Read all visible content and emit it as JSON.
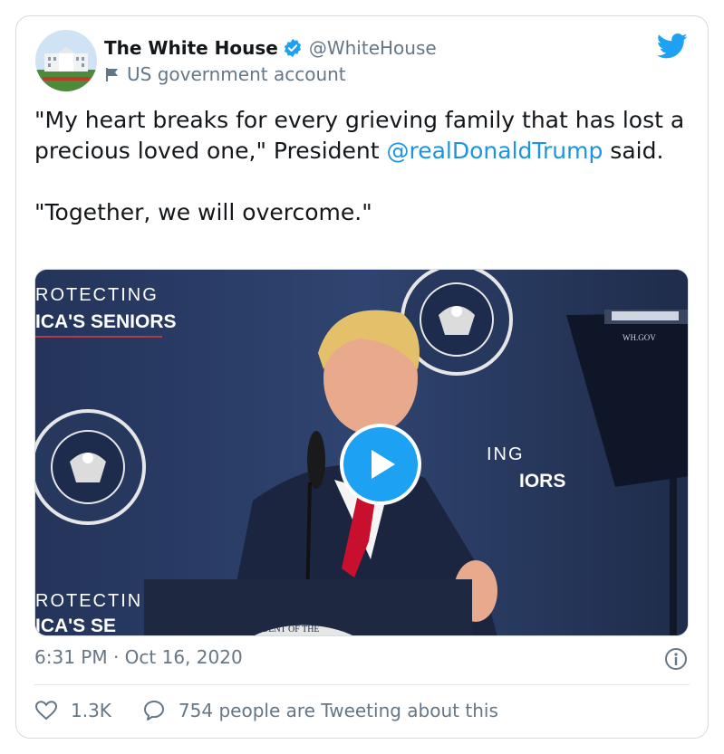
{
  "account": {
    "display_name": "The White House",
    "handle": "@WhiteHouse",
    "label": "US government account",
    "verified": true
  },
  "tweet": {
    "text_before_mention": "\"My heart breaks for every grieving family that has lost a precious loved one,\" President ",
    "mention": "@realDonaldTrump",
    "text_after_mention": " said.",
    "second_paragraph": "\"Together, we will overcome.\""
  },
  "media": {
    "banner_top_line1": "ROTECTING",
    "banner_top_line2": "ICA'S SENIORS",
    "banner_mid_line1": "ING",
    "banner_mid_line2": "IORS",
    "banner_bottom_line1": "ROTECTIN",
    "banner_bottom_line2": "ICA'S SE",
    "seal_text": "SEAL OF THE PRESIDENT OF THE UNITED STATES",
    "podium_text": "DENT OF THE",
    "teleprompter_text": "WH.GOV"
  },
  "meta": {
    "time": "6:31 PM",
    "separator": " · ",
    "date": "Oct 16, 2020"
  },
  "actions": {
    "like_count": "1.3K",
    "reply_text": "754 people are Tweeting about this"
  },
  "colors": {
    "accent": "#1da1f2",
    "mention": "#1b95e0",
    "secondary_text": "#657786",
    "tie_red": "#c8102e"
  },
  "icons": [
    "verified-badge-icon",
    "flag-icon",
    "twitter-bird-icon",
    "play-icon",
    "info-icon",
    "heart-icon",
    "comment-icon"
  ]
}
